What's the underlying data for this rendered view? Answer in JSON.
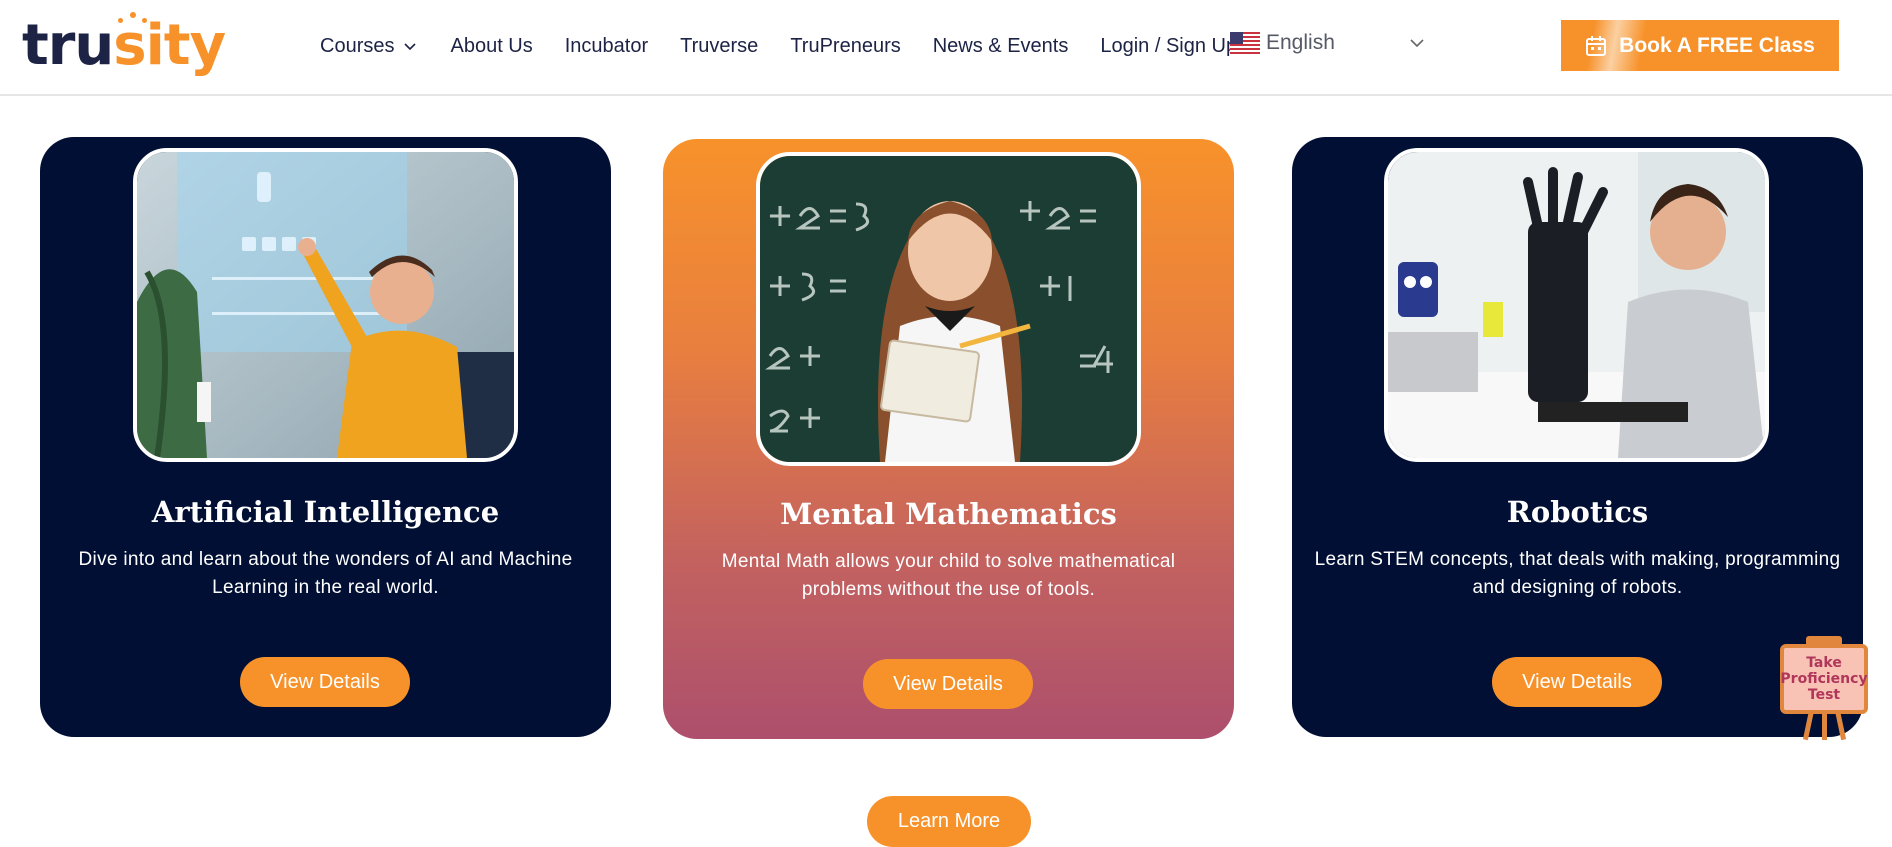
{
  "brand": {
    "logo_part1": "tru",
    "logo_part2": "sity",
    "colors": {
      "navy": "#000f33",
      "orange": "#f7922b",
      "pink": "#ad4f6d"
    }
  },
  "nav": {
    "items": [
      {
        "label": "Courses",
        "has_dropdown": true
      },
      {
        "label": "About Us"
      },
      {
        "label": "Incubator"
      },
      {
        "label": "Truverse"
      },
      {
        "label": "TruPreneurs"
      },
      {
        "label": "News & Events"
      },
      {
        "label": "Login / Sign Up"
      }
    ],
    "language": {
      "selected": "English",
      "flag_icon": "us-flag-icon"
    },
    "cta": {
      "label": "Book A FREE Class",
      "icon": "calendar-icon"
    }
  },
  "cards": [
    {
      "title": "Artificial Intelligence",
      "description": "Dive into and learn about the wonders of AI and Machine Learning in the real world.",
      "button": "View Details"
    },
    {
      "title": "Mental Mathematics",
      "description": "Mental Math allows your child to solve mathematical problems without the use of tools.",
      "button": "View Details"
    },
    {
      "title": "Robotics",
      "description": "Learn STEM concepts, that deals with making, programming and designing of robots.",
      "button": "View Details"
    }
  ],
  "learn_more": "Learn More",
  "proficiency": {
    "line1": "Take",
    "line2": "Proficiency",
    "line3": "Test"
  }
}
